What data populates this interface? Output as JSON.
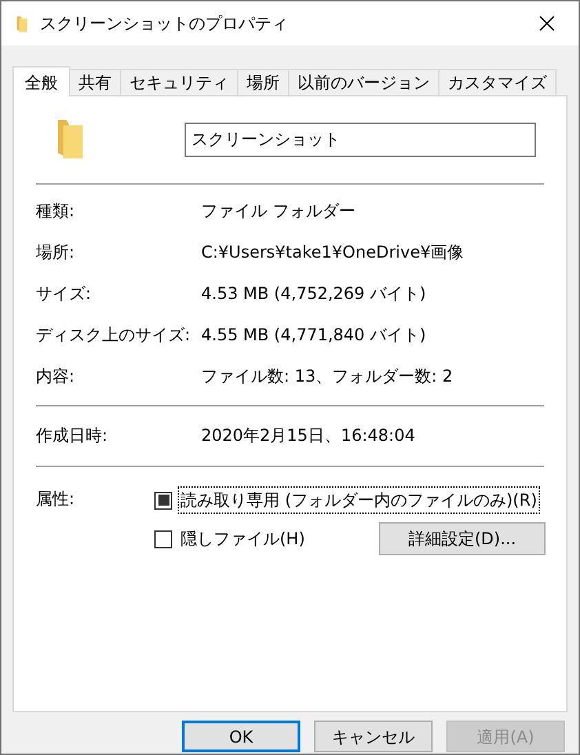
{
  "window": {
    "title": "スクリーンショットのプロパティ"
  },
  "tabs": [
    {
      "label": "全般",
      "selected": true
    },
    {
      "label": "共有",
      "selected": false
    },
    {
      "label": "セキュリティ",
      "selected": false
    },
    {
      "label": "場所",
      "selected": false
    },
    {
      "label": "以前のバージョン",
      "selected": false
    },
    {
      "label": "カスタマイズ",
      "selected": false
    }
  ],
  "name_field": {
    "value": "スクリーンショット"
  },
  "properties": [
    {
      "label": "種類:",
      "value": "ファイル フォルダー"
    },
    {
      "label": "場所:",
      "value": "C:¥Users¥take1¥OneDrive¥画像"
    },
    {
      "label": "サイズ:",
      "value": "4.53 MB (4,752,269 バイト)"
    },
    {
      "label": "ディスク上のサイズ:",
      "value": "4.55 MB (4,771,840 バイト)"
    },
    {
      "label": "内容:",
      "value": "ファイル数: 13、フォルダー数: 2"
    }
  ],
  "dates": [
    {
      "label": "作成日時:",
      "value": "2020年2月15日、16:48:04"
    }
  ],
  "attributes": {
    "label": "属性:",
    "options": [
      {
        "label": "読み取り専用 (フォルダー内のファイルのみ)(R)",
        "checked": true,
        "indeterminate": true,
        "focused": true
      },
      {
        "label": "隠しファイル(H)",
        "checked": false,
        "indeterminate": false,
        "focused": false
      }
    ],
    "advanced_button": "詳細設定(D)..."
  },
  "buttons": [
    {
      "label": "OK",
      "default": true,
      "disabled": false
    },
    {
      "label": "キャンセル",
      "default": false,
      "disabled": false
    },
    {
      "label": "適用(A)",
      "default": false,
      "disabled": true
    }
  ]
}
